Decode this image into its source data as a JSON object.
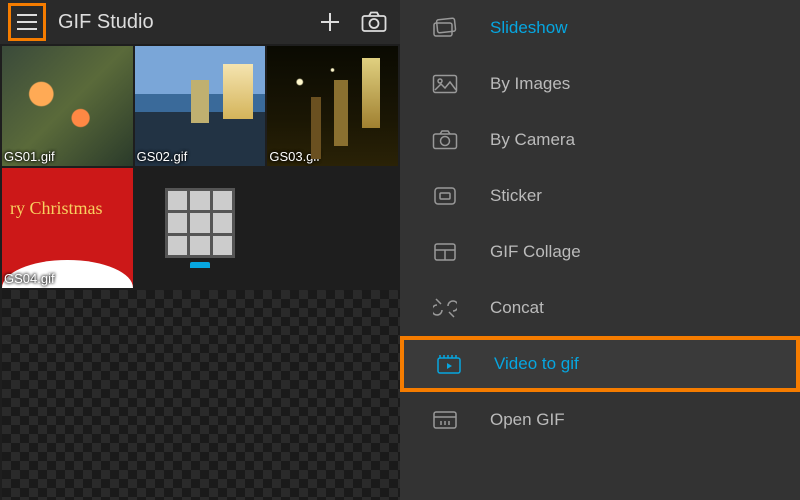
{
  "header": {
    "title": "GIF Studio"
  },
  "thumbnails": [
    {
      "caption": "GS01.gif"
    },
    {
      "caption": "GS02.gif"
    },
    {
      "caption": "GS03.gif"
    },
    {
      "caption": "GS04.gif",
      "overlay": "ry Christmas"
    },
    {
      "caption": ""
    }
  ],
  "menu": {
    "items": [
      {
        "label": "Slideshow",
        "icon": "slideshow-icon",
        "highlighted": false,
        "accent": true
      },
      {
        "label": "By Images",
        "icon": "images-icon",
        "highlighted": false
      },
      {
        "label": "By Camera",
        "icon": "camera-icon",
        "highlighted": false
      },
      {
        "label": "Sticker",
        "icon": "sticker-icon",
        "highlighted": false
      },
      {
        "label": "GIF Collage",
        "icon": "collage-icon",
        "highlighted": false
      },
      {
        "label": "Concat",
        "icon": "concat-icon",
        "highlighted": false
      },
      {
        "label": "Video to gif",
        "icon": "video-icon",
        "highlighted": true
      },
      {
        "label": "Open GIF",
        "icon": "open-gif-icon",
        "highlighted": false
      }
    ]
  },
  "colors": {
    "accent": "#06a6e0",
    "highlight_border": "#f57c00"
  }
}
